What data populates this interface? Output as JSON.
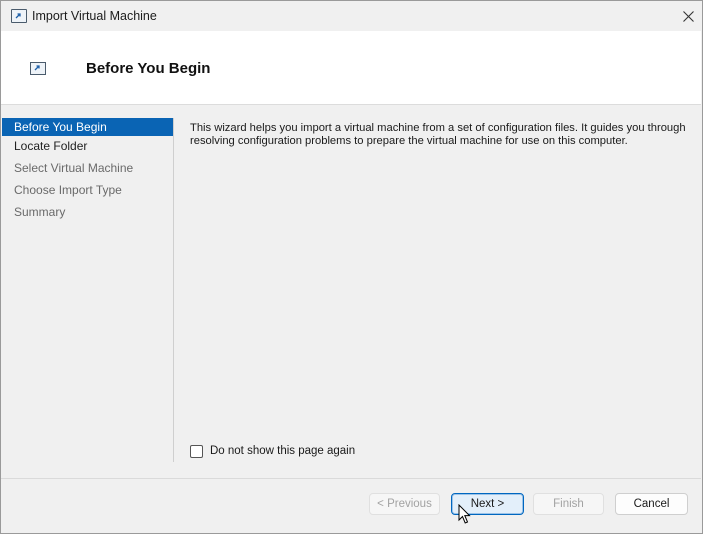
{
  "window": {
    "title": "Import Virtual Machine",
    "title_icon": "import-vm-icon",
    "close_icon": "close-icon"
  },
  "header": {
    "title": "Before You Begin",
    "icon": "import-vm-icon"
  },
  "nav": {
    "items": [
      {
        "label": "Before You Begin",
        "state": "active"
      },
      {
        "label": "Locate Folder",
        "state": "enabled"
      },
      {
        "label": "Select Virtual Machine",
        "state": "disabled"
      },
      {
        "label": "Choose Import Type",
        "state": "disabled"
      },
      {
        "label": "Summary",
        "state": "disabled"
      }
    ]
  },
  "content": {
    "description": "This wizard helps you import a virtual machine from a set of configuration files. It guides you through resolving configuration problems to prepare the virtual machine for use on this computer."
  },
  "checkbox": {
    "label": "Do not show this page again",
    "checked": false
  },
  "buttons": {
    "previous": "< Previous",
    "next": "Next >",
    "finish": "Finish",
    "cancel": "Cancel"
  },
  "colors": {
    "accent": "#0a64b4",
    "primary_button_border": "#0067c0"
  }
}
